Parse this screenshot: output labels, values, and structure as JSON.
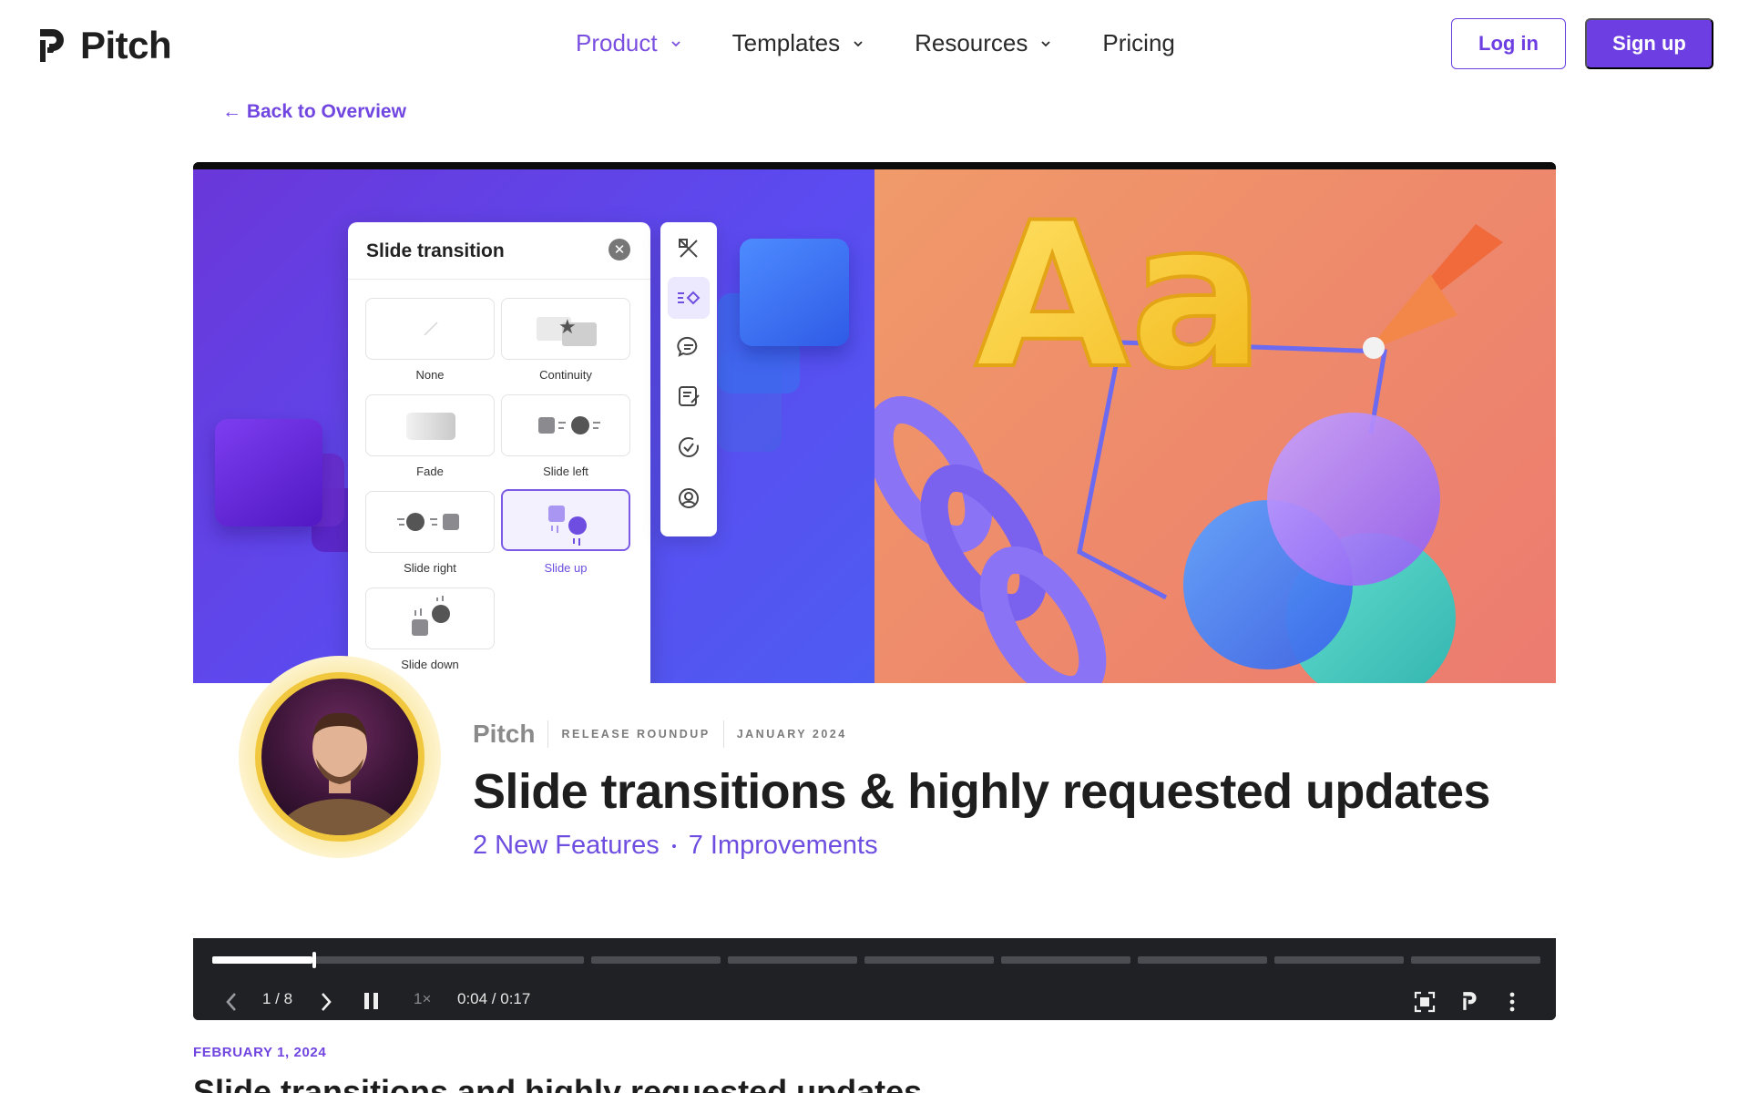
{
  "brand": {
    "name": "Pitch"
  },
  "nav": {
    "items": [
      {
        "label": "Product",
        "active": true,
        "has_dropdown": true
      },
      {
        "label": "Templates",
        "active": false,
        "has_dropdown": true
      },
      {
        "label": "Resources",
        "active": false,
        "has_dropdown": true
      },
      {
        "label": "Pricing",
        "active": false,
        "has_dropdown": false
      }
    ],
    "login_label": "Log in",
    "signup_label": "Sign up"
  },
  "back_link": "← Back to Overview",
  "video": {
    "dialog": {
      "title": "Slide transition",
      "options": [
        {
          "label": "None",
          "selected": false
        },
        {
          "label": "Continuity",
          "selected": false
        },
        {
          "label": "Fade",
          "selected": false
        },
        {
          "label": "Slide left",
          "selected": false
        },
        {
          "label": "Slide right",
          "selected": false
        },
        {
          "label": "Slide up",
          "selected": true
        },
        {
          "label": "Slide down",
          "selected": false
        }
      ]
    },
    "toolbar_icons": [
      "design-tools-icon",
      "transition-icon",
      "comment-icon",
      "notes-icon",
      "check-circle-icon",
      "user-circle-icon"
    ],
    "hero_letters": "Aa",
    "card": {
      "brand": "Pitch",
      "tag": "RELEASE ROUNDUP",
      "month": "JANUARY 2024",
      "headline": "Slide transitions & highly requested updates",
      "features": "2 New Features",
      "improvements": "7 Improvements"
    },
    "controls": {
      "slide_counter": "1 / 8",
      "speed": "1×",
      "time": "0:04 / 0:17",
      "segments": 8,
      "current_segment_progress": 0.27
    }
  },
  "article": {
    "date": "FEBRUARY 1, 2024",
    "title": "Slide transitions and highly requested updates"
  },
  "colors": {
    "accent": "#6d3fe3",
    "hero_left": "#5b4bf0",
    "hero_right": "#ee8a6b",
    "controls_bg": "#202124"
  }
}
